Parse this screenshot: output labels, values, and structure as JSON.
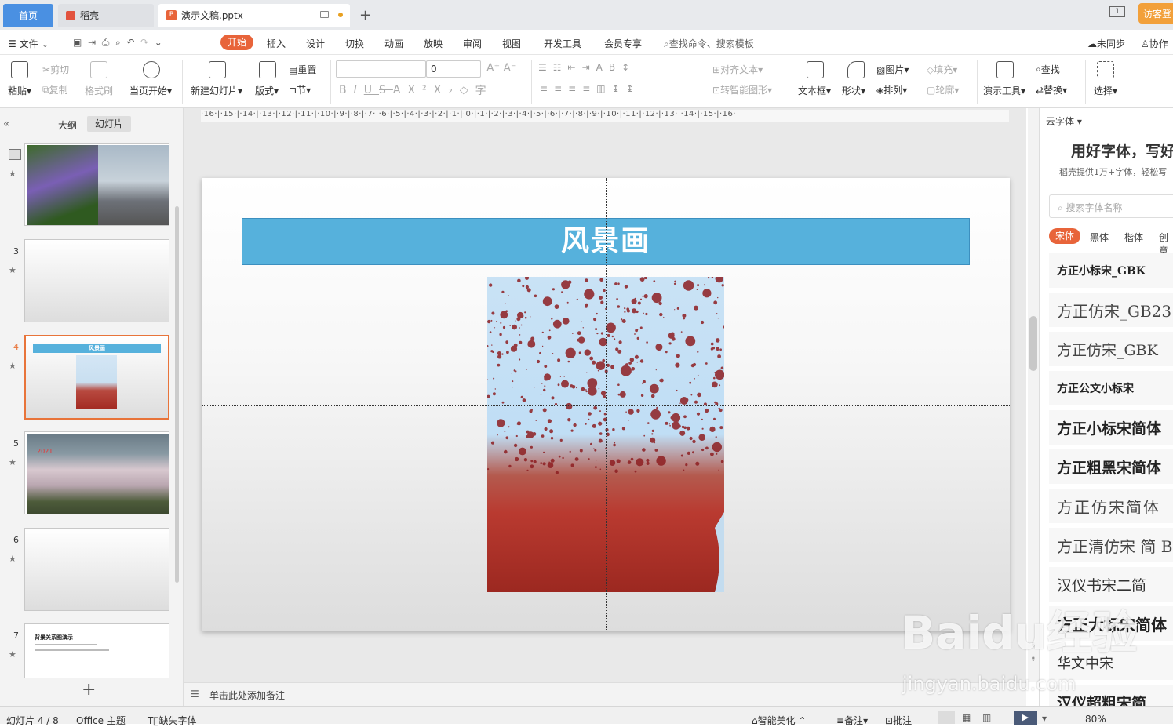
{
  "tabs": {
    "home": "首页",
    "docer": "稻壳",
    "document": "演示文稿.pptx"
  },
  "visitor_button": "访客登",
  "menu": {
    "file": "文件",
    "items": [
      "开始",
      "插入",
      "设计",
      "切换",
      "动画",
      "放映",
      "审阅",
      "视图",
      "开发工具",
      "会员专享"
    ],
    "search": "查找命令、搜索模板",
    "sync": "未同步",
    "collab": "协作"
  },
  "ribbon": {
    "paste": "粘贴",
    "cut": "剪切",
    "copy": "复制",
    "format_painter": "格式刷",
    "from_current": "当页开始",
    "new_slide": "新建幻灯片",
    "layout": "版式",
    "reset": "重置",
    "section": "节",
    "font_name": "",
    "font_size": "0",
    "align_text": "对齐文本",
    "convert_smartart": "转智能图形",
    "textbox": "文本框",
    "shape": "形状",
    "picture": "图片",
    "arrange": "排列",
    "fill": "填充",
    "outline": "轮廓",
    "present_tools": "演示工具",
    "find": "查找",
    "replace": "替换",
    "select": "选择"
  },
  "left_panel": {
    "outline_tab": "大纲",
    "slides_tab": "幻灯片",
    "slide_numbers": [
      "3",
      "4",
      "5",
      "6",
      "7"
    ]
  },
  "thumbnails": {
    "slide4_title": "风景画",
    "slide5_year": "2021",
    "slide7_title": "背景关系图演示"
  },
  "ruler": "·16·|·15·|·14·|·13·|·12·|·11·|·10·|·9·|·8·|·7·|·6·|·5·|·4·|·3·|·2·|·1·|·0·|·1·|·2·|·3·|·4·|·5·|·6·|·7·|·8·|·9·|·10·|·11·|·12·|·13·|·14·|·15·|·16·",
  "slide": {
    "title": "风景画"
  },
  "notes_placeholder": "单击此处添加备注",
  "right_panel": {
    "header": "云字体",
    "promo_title": "用好字体，写好",
    "promo_sub": "稻壳提供1万+字体，轻松写",
    "search_placeholder": "搜索字体名称",
    "categories": [
      "宋体",
      "黑体",
      "楷体",
      "创意"
    ],
    "fonts": [
      "方正小标宋_GBK",
      "方正仿宋_GB2312",
      "方正仿宋_GBK",
      "方正公文小标宋",
      "方正小标宋简体",
      "方正粗黑宋简体",
      "方正仿宋简体",
      "方正清仿宋 简 B",
      "汉仪书宋二简",
      "方正大标宋简体",
      "华文中宋",
      "汉仪超粗宋简"
    ]
  },
  "status": {
    "slide_count": "幻灯片 4 / 8",
    "theme": "Office 主题",
    "missing_font": "缺失字体",
    "beautify": "智能美化",
    "notes": "备注",
    "comments": "批注",
    "zoom": "80%"
  },
  "watermark": {
    "brand": "Baidu经验",
    "url": "jingyan.baidu.com"
  }
}
